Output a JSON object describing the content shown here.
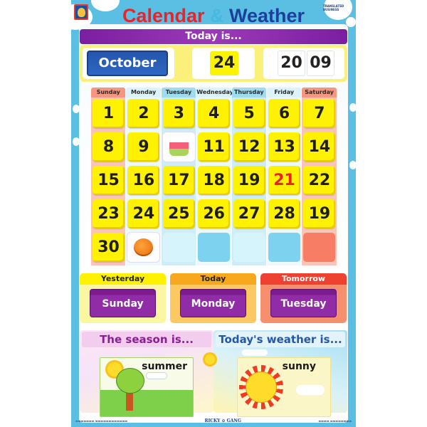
{
  "poster": {
    "title": {
      "word1": "Calendar",
      "amp": "&",
      "word2": "Weather"
    },
    "publisher_logo_right": "TRANSLATED BUSINESS",
    "today_is_label": "Today is...",
    "date": {
      "month": "October",
      "day": "24",
      "year_part1": "20",
      "year_part2": "09"
    }
  },
  "calendar": {
    "weekdays": [
      "Sunday",
      "Monday",
      "Tuesday",
      "Wednesday",
      "Thursday",
      "Friday",
      "Saturday"
    ],
    "weeks": [
      [
        {
          "text": "1"
        },
        {
          "text": "2"
        },
        {
          "text": "3"
        },
        {
          "text": "4"
        },
        {
          "text": "5"
        },
        {
          "text": "6"
        },
        {
          "text": "7"
        }
      ],
      [
        {
          "text": "8"
        },
        {
          "text": "9"
        },
        {
          "icon": "birthday-cake-icon"
        },
        {
          "text": "11"
        },
        {
          "text": "12"
        },
        {
          "text": "13"
        },
        {
          "text": "14"
        }
      ],
      [
        {
          "text": "15"
        },
        {
          "text": "16"
        },
        {
          "text": "17"
        },
        {
          "text": "18"
        },
        {
          "text": "19"
        },
        {
          "text": "21",
          "highlight": "red"
        },
        {
          "text": "22"
        }
      ],
      [
        {
          "text": "23"
        },
        {
          "text": "24"
        },
        {
          "text": "25"
        },
        {
          "text": "26"
        },
        {
          "text": "27"
        },
        {
          "text": "28"
        },
        {
          "text": "19"
        }
      ],
      [
        {
          "text": "30"
        },
        {
          "icon": "pumpkin-icon"
        },
        {
          "empty": "light"
        },
        {
          "empty": "blue"
        },
        {
          "empty": "light"
        },
        {
          "empty": "blue"
        },
        {
          "empty": "red"
        }
      ]
    ],
    "colors": {
      "weekend": "#f59680",
      "weekday_dark": "#9fdcf0",
      "weekday_light": "#dcf3fa",
      "cell": "#fff200",
      "highlight": "#e8241c"
    }
  },
  "relative_days": [
    {
      "label": "Yesterday",
      "value": "Sunday",
      "label_color": "#fff200",
      "bg_color": "#fbf6a0",
      "text_color": "#222222"
    },
    {
      "label": "Today",
      "value": "Monday",
      "label_color": "#f7a81c",
      "bg_color": "#fbc861",
      "text_color": "#222222"
    },
    {
      "label": "Tomorrow",
      "value": "Tuesday",
      "label_color": "#ef4130",
      "bg_color": "#f68f6d",
      "text_color": "#ffffff"
    }
  ],
  "season": {
    "title": "The season is...",
    "value": "summer"
  },
  "weather": {
    "title": "Today's weather is...",
    "value": "sunny"
  },
  "footer": {
    "brand": "RICKY ⊙ GANG"
  }
}
